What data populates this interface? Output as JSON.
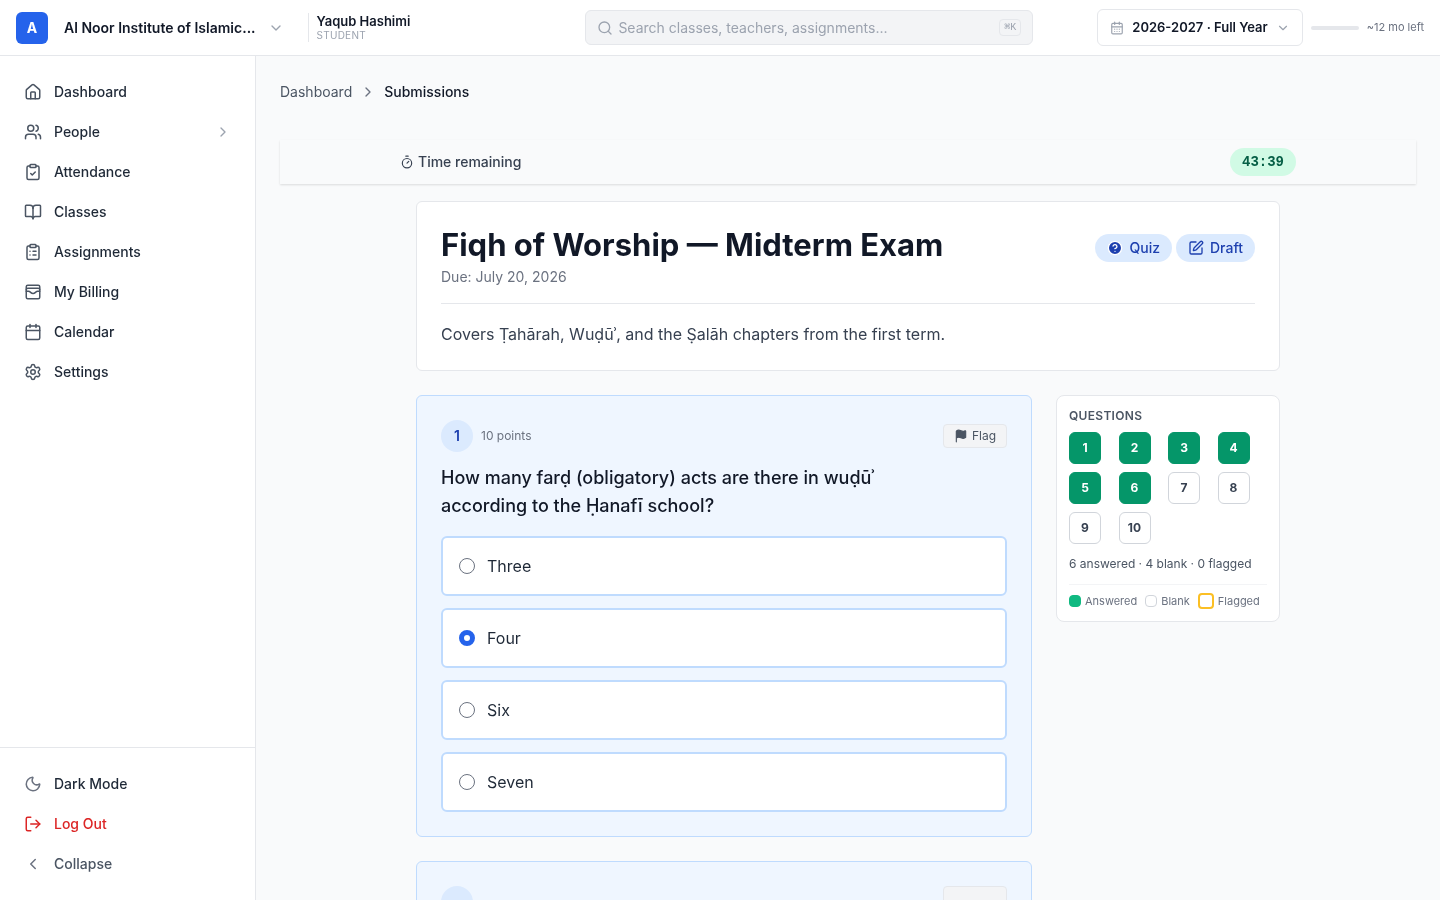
{
  "header": {
    "logo_letter": "A",
    "org_name": "Al Noor Institute of Islamic...",
    "user_name": "Yaqub Hashimi",
    "user_role": "STUDENT",
    "search_placeholder": "Search classes, teachers, assignments...",
    "search_shortcut": "⌘K",
    "term": "2026-2027 · Full Year",
    "term_remaining": "~12 mo left"
  },
  "sidebar": {
    "items": [
      {
        "label": "Dashboard",
        "has_submenu": false
      },
      {
        "label": "People",
        "has_submenu": true
      },
      {
        "label": "Attendance",
        "has_submenu": false
      },
      {
        "label": "Classes",
        "has_submenu": false
      },
      {
        "label": "Assignments",
        "has_submenu": false
      },
      {
        "label": "My Billing",
        "has_submenu": false
      },
      {
        "label": "Calendar",
        "has_submenu": false
      },
      {
        "label": "Settings",
        "has_submenu": false
      }
    ],
    "bottom_items": [
      {
        "label": "Dark Mode",
        "kind": "normal"
      },
      {
        "label": "Log Out",
        "kind": "danger"
      },
      {
        "label": "Collapse",
        "kind": "muted"
      }
    ]
  },
  "breadcrumb": [
    "Dashboard",
    "Submissions"
  ],
  "timer": {
    "label": "Time remaining",
    "value": "43:39"
  },
  "exam": {
    "title": "Fiqh of Worship — Midterm Exam",
    "due": "Due: July 20, 2026",
    "badges": [
      {
        "label": "Quiz",
        "kind": "type"
      },
      {
        "label": "Draft",
        "kind": "status"
      }
    ],
    "description": "Covers Ṭahārah, Wuḍūʾ, and the Ṣalāh chapters from the first term."
  },
  "questions": [
    {
      "number": "1",
      "points": "10 points",
      "flag_label": "Flag",
      "text": "How many farḍ (obligatory) acts are there in wuḍūʾ according to the Ḥanafī school?",
      "options": [
        {
          "label": "Three",
          "selected": false
        },
        {
          "label": "Four",
          "selected": true
        },
        {
          "label": "Six",
          "selected": false
        },
        {
          "label": "Seven",
          "selected": false
        }
      ]
    },
    {
      "kind": "cut_off"
    }
  ],
  "navigator": {
    "title": "QUESTIONS",
    "items": [
      {
        "label": "1",
        "answered": true
      },
      {
        "label": "2",
        "answered": true
      },
      {
        "label": "3",
        "answered": true
      },
      {
        "label": "4",
        "answered": true
      },
      {
        "label": "5",
        "answered": true
      },
      {
        "label": "6",
        "answered": true
      },
      {
        "label": "7",
        "answered": false
      },
      {
        "label": "8",
        "answered": false
      },
      {
        "label": "9",
        "answered": false
      },
      {
        "label": "10",
        "answered": false
      }
    ],
    "summary": "6 answered · 4 blank · 0 flagged",
    "legend": [
      {
        "label": "Answered",
        "kind": "answered"
      },
      {
        "label": "Blank",
        "kind": "blank"
      },
      {
        "label": "Flagged",
        "kind": "flagged"
      }
    ]
  }
}
